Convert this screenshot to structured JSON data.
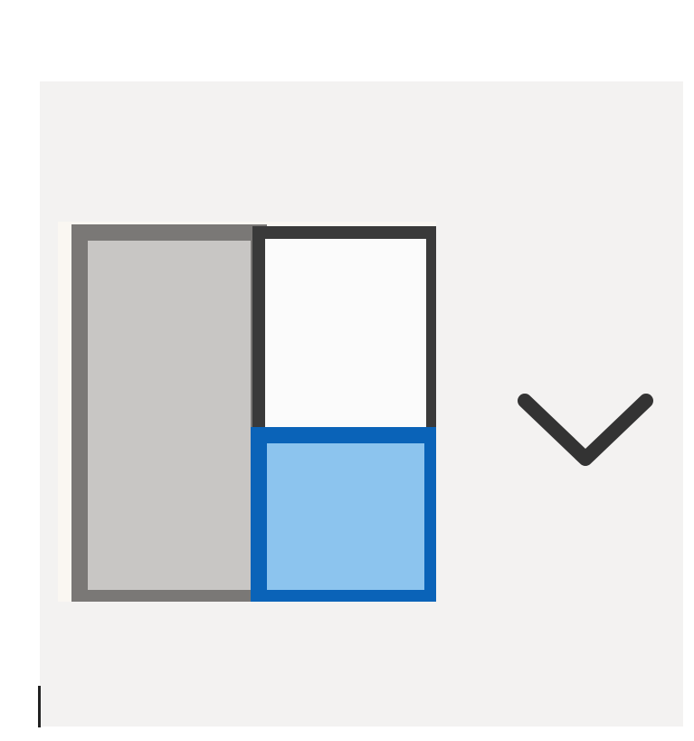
{
  "toolbar": {
    "layout_button": {
      "icon": "layout-left-column-right-split-icon",
      "dropdown_icon": "chevron-down-icon"
    }
  },
  "colors": {
    "background": "#f3f2f1",
    "left_pane_fill": "#c8c6c4",
    "left_pane_border": "#7a7876",
    "top_right_fill": "#fbfbfb",
    "top_right_border": "#3a3a3a",
    "bottom_right_fill": "#8cc4ee",
    "bottom_right_border": "#0a63b8",
    "chevron": "#333333"
  }
}
